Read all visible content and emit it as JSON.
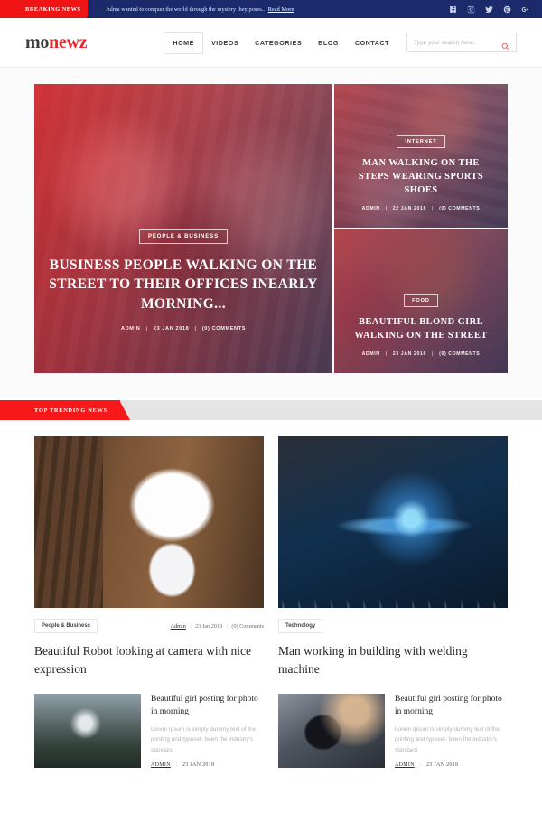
{
  "topbar": {
    "breaking_label": "BREAKING NEWS",
    "breaking_text": "Julma wanted to conquer the world through the mystery they poses..",
    "read_more": "Read More",
    "social": [
      {
        "name": "facebook-icon",
        "glyph": "f"
      },
      {
        "name": "instagram-icon",
        "glyph": "▣"
      },
      {
        "name": "twitter-icon",
        "glyph": "🐦"
      },
      {
        "name": "pinterest-icon",
        "glyph": "P"
      },
      {
        "name": "google-plus-icon",
        "glyph": "G+"
      }
    ],
    "bg_color": "#1b2a6b",
    "accent_color": "#f01414"
  },
  "header": {
    "logo_part1": "mo",
    "logo_part2": "newz",
    "nav": [
      {
        "label": "HOME",
        "active": true
      },
      {
        "label": "VIDEOS",
        "active": false
      },
      {
        "label": "CATEGORIES",
        "active": false
      },
      {
        "label": "BLOG",
        "active": false
      },
      {
        "label": "CONTACT",
        "active": false
      }
    ],
    "search_placeholder": "Type your search here.."
  },
  "hero": {
    "main": {
      "category": "PEOPLE & BUSINESS",
      "title": "BUSINESS PEOPLE WALKING ON THE STREET TO THEIR OFFICES INEARLY MORNING...",
      "author": "ADMIN",
      "date": "23 JAN 2018",
      "comments": "(0) COMMENTS"
    },
    "secondary": [
      {
        "category": "INTERNET",
        "title": "MAN WALKING ON THE STEPS WEARING SPORTS SHOES",
        "author": "ADMIN",
        "date": "22 JAN 2018",
        "comments": "(0) COMMENTS"
      },
      {
        "category": "FOOD",
        "title": "BEAUTIFUL BLOND GIRL WALKING ON THE STREET",
        "author": "ADMIN",
        "date": "23 JAN 2018",
        "comments": "(0) COMMENTS"
      }
    ]
  },
  "trending": {
    "label": "TOP TRENDING NEWS",
    "accent_color": "#f71919",
    "bar_color": "#e4e4e4"
  },
  "articles": {
    "left": {
      "tag": "People & Business",
      "author": "Admin",
      "date": "23 Jan 2018",
      "comments": "(0) Comments",
      "title": "Beautiful Robot looking at camera with nice expression",
      "sub": {
        "title": "Beautiful girl posting for photo in morning",
        "excerpt": "Lorem Ipsum is simply dummy text of the printing and typeset- been the industry's standard",
        "author": "ADMIN",
        "date": "23 JAN 2018"
      }
    },
    "right": {
      "tag": "Technology",
      "title": "Man working in building with welding machine",
      "sub": {
        "title": "Beautiful girl posting for photo in morning",
        "excerpt": "Lorem Ipsum is simply dummy text of the printing and typeset- been the industry's standard",
        "author": "ADMIN",
        "date": "23 JAN 2018"
      }
    }
  }
}
